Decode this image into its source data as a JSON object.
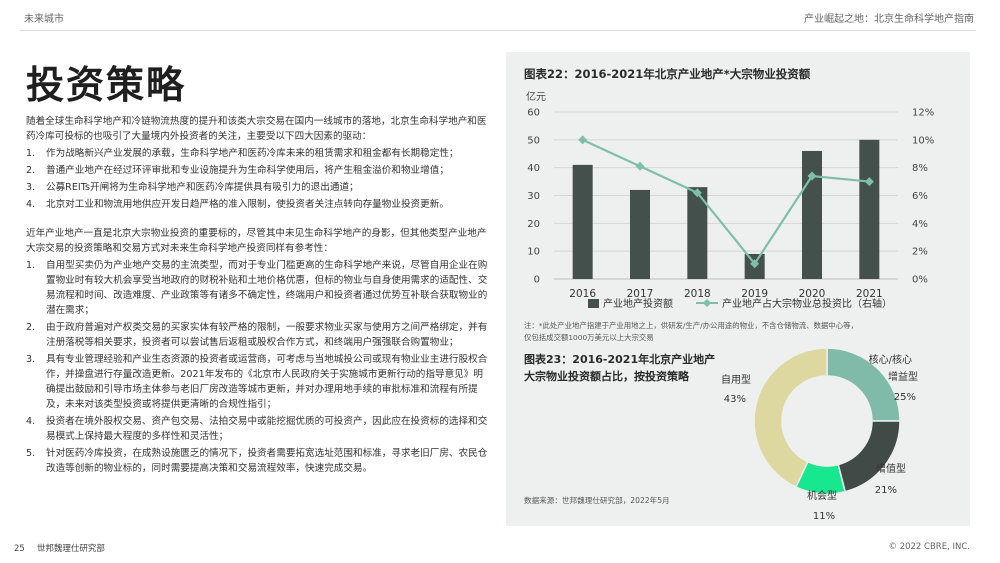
{
  "header": {
    "left": "未来城市",
    "right": "产业崛起之地：北京生命科学地产指南"
  },
  "title": "投资策略",
  "body": {
    "intro": "随着全球生命科学地产和冷链物流热度的提升和该类大宗交易在国内一线城市的落地，北京生命科学地产和医药冷库可投标的也吸引了大量境内外投资者的关注，主要受以下四大因素的驱动：",
    "drivers": [
      {
        "num": "1.",
        "text": "作为战略新兴产业发展的承载，生命科学地产和医药冷库未来的租赁需求和租金都有长期稳定性；"
      },
      {
        "num": "2.",
        "text": "普通产业地产在经过环评审批和专业设施提升为生命科学使用后，将产生租金溢价和物业增值；"
      },
      {
        "num": "3.",
        "text": "公募REITs开闸将为生命科学地产和医药冷库提供具有吸引力的退出通道；"
      },
      {
        "num": "4.",
        "text": "北京对工业和物流用地供应开发日趋严格的准入限制，使投资者关注点转向存量物业投资更新。"
      }
    ],
    "para2": "近年产业地产一直是北京大宗物业投资的重要标的，尽管其中未见生命科学地产的身影，但其他类型产业地产大宗交易的投资策略和交易方式对未来生命科学地产投资同样有参考性：",
    "strategies": [
      {
        "num": "1.",
        "text": "自用型买卖仍为产业地产交易的主流类型，而对于专业门槛更高的生命科学地产来说，尽管自用企业在购置物业时有较大机会享受当地政府的财税补贴和土地价格优惠，但标的物业与自身使用需求的适配性、交易流程和时间、改造难度、产业政策等有诸多不确定性，终端用户和投资者通过优势互补联合获取物业的潜在需求；"
      },
      {
        "num": "2.",
        "text": "由于政府普遍对产权类交易的买家实体有较严格的限制，一般要求物业买家与使用方之间严格绑定，并有注册落税等相关要求，投资者可以尝试售后返租或股权合作方式，和终端用户强强联合购置物业；"
      },
      {
        "num": "3.",
        "text": "具有专业管理经验和产业生态资源的投资者或运营商，可考虑与当地城投公司或现有物业业主进行股权合作，并操盘进行存量改造更新。2021年发布的《北京市人民政府关于实施城市更新行动的指导意见》明确提出鼓励和引导市场主体参与老旧厂房改造等城市更新，并对办理用地手续的审批标准和流程有所提及，未来对该类型投资或将提供更清晰的合规性指引；"
      },
      {
        "num": "4.",
        "text": "投资者在境外股权交易、资产包交易、法拍交易中或能挖掘优质的可投资产，因此应在投资标的选择和交易模式上保持最大程度的多样性和灵活性；"
      },
      {
        "num": "5.",
        "text": "针对医药冷库投资，在成熟设施匮乏的情况下，投资者需要拓宽选址范围和标准，寻求老旧厂房、农民仓改造等创新的物业标的，同时需要提高决策和交易流程效率，快速完成交易。"
      }
    ]
  },
  "chart22": {
    "title": "图表22：2016-2021年北京产业地产*大宗物业投资额",
    "left_unit": "亿元",
    "legend_bar": "产业地产投资额",
    "legend_line": "产业地产占大宗物业总投资比（右轴）",
    "note1": "注：*此处产业地产指建于产业用地之上，供研发/生产/办公用途的物业，不含仓储物流、数据中心等，",
    "note2": "仅包括成交额1000万美元以上大宗交易"
  },
  "chart23": {
    "title_line1": "图表23：2016-2021年北京产业地产",
    "title_line2": "大宗物业投资额占比，按投资策略",
    "source": "数据来源：世邦魏理仕研究部，2022年5月"
  },
  "footer": {
    "page": "25",
    "left": "世邦魏理仕研究部",
    "right": "© 2022 CBRE, INC."
  },
  "chart_data": [
    {
      "type": "bar",
      "title": "图表22：2016-2021年北京产业地产*大宗物业投资额",
      "categories": [
        "2016",
        "2017",
        "2018",
        "2019",
        "2020",
        "2021"
      ],
      "series": [
        {
          "name": "产业地产投资额",
          "type": "bar",
          "axis": "left",
          "values": [
            41,
            32,
            33,
            9,
            46,
            50
          ],
          "color": "#44504c"
        },
        {
          "name": "产业地产占大宗物业总投资比（右轴）",
          "type": "line",
          "axis": "right",
          "values": [
            0.1,
            0.081,
            0.062,
            0.011,
            0.074,
            0.07
          ],
          "color": "#7dbfa9"
        }
      ],
      "ylabel": "亿元",
      "ylim": [
        0,
        60
      ],
      "yticks": [
        "0",
        "10",
        "20",
        "30",
        "40",
        "50",
        "60"
      ],
      "y2lim": [
        0,
        0.12
      ],
      "y2ticks": [
        "0%",
        "2%",
        "4%",
        "6%",
        "8%",
        "10%",
        "12%"
      ],
      "grid": true,
      "legend": "bottom"
    },
    {
      "type": "pie",
      "title": "图表23：2016-2021年北京产业地产大宗物业投资额占比，按投资策略",
      "categories": [
        "核心/核心增益型",
        "增值型",
        "机会型",
        "自用型"
      ],
      "values": [
        25,
        21,
        11,
        43
      ],
      "value_labels": [
        "25%",
        "21%",
        "11%",
        "43%"
      ],
      "colors": [
        "#80bba9",
        "#404b48",
        "#17e88f",
        "#dcd89f"
      ]
    }
  ]
}
